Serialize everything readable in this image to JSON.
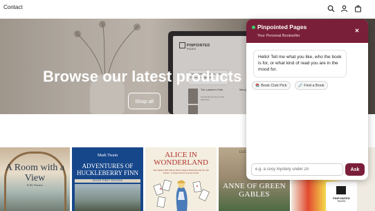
{
  "header": {
    "nav_contact": "Contact",
    "icons": [
      "search-icon",
      "account-icon",
      "cart-icon"
    ]
  },
  "hero": {
    "title": "Browse our latest products",
    "button_label": "Shop all",
    "laptop_screen": {
      "logo_text": "PINPOINTED",
      "logo_subtext": "PAGES",
      "bubble_text": "Great choice, Here are a few books you might love:",
      "card_title": "The Lantern's Path",
      "card_subtitle": "Mercy",
      "card_author": "A powerful journey of self-discovery..."
    }
  },
  "books": [
    {
      "title": "A Room with a View",
      "author": "E.M. Forster"
    },
    {
      "author": "Mark Twain",
      "title": "ADVENTURES OF HUCKLEBERRY FINN",
      "edition": "DOVER THRIFT EDITIONS"
    },
    {
      "title": "ALICE IN WONDERLAND",
      "subtitle": "The Original 1865 Edition With Complete Illustrations By Sir John Tenniel · A Classic Novel of Lewis Carroll"
    },
    {
      "author": "LUCY MAUD MONTGOMERY",
      "title": "ANNE OF GREEN GABLES"
    },
    {
      "logo_text": "PINPOINTED",
      "logo_subtext": "PAGES"
    }
  ],
  "chat": {
    "title": "Pinpointed Pages",
    "subtitle": "Your Personal Bookseller",
    "close_symbol": "✕",
    "bot_message": "Hello! Tell me what you like, who the book is for, or what kind of read you are in the mood for.",
    "chips": [
      {
        "icon": "book-icon",
        "glyph": "📚",
        "label": "Book Club Pick"
      },
      {
        "icon": "magnifier-icon",
        "glyph": "🔎",
        "label": "Find a Book"
      }
    ],
    "input_placeholder": "e.g. a cosy mystery under 20",
    "ask_label": "Ask"
  },
  "colors": {
    "brand": "#7a1f3a",
    "online": "#3ccf6b",
    "hero_text": "#ffffff"
  }
}
